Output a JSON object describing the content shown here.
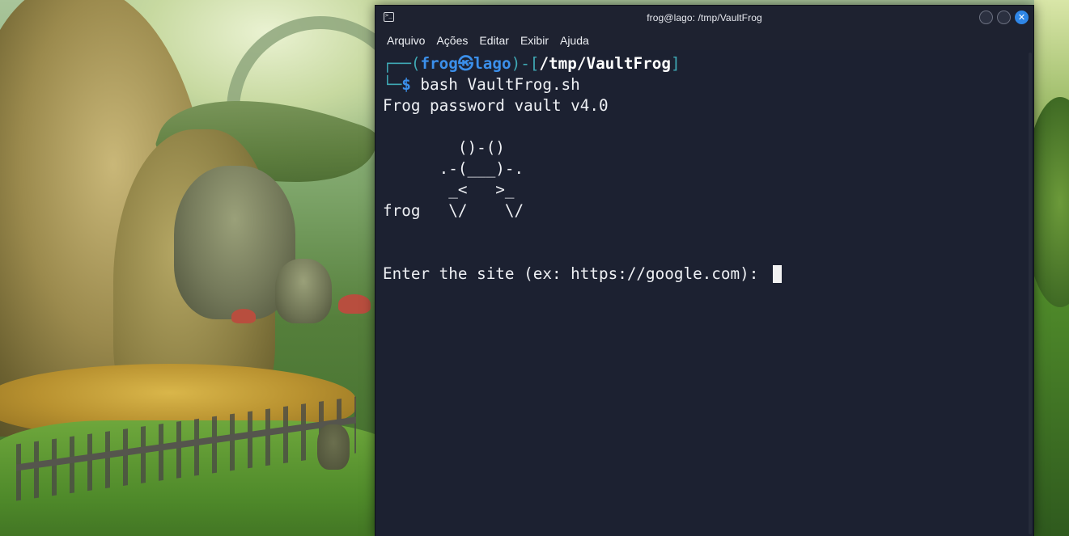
{
  "window": {
    "title": "frog@lago: /tmp/VaultFrog",
    "app_icon": "terminal-icon",
    "app_icon_glyph": ">_",
    "controls": [
      {
        "name": "minimize-button",
        "glyph": ""
      },
      {
        "name": "maximize-button",
        "glyph": ""
      },
      {
        "name": "close-button",
        "glyph": "✕"
      }
    ]
  },
  "menu": {
    "items": [
      "Arquivo",
      "Ações",
      "Editar",
      "Exibir",
      "Ajuda"
    ]
  },
  "prompt": {
    "line1_prefix": "┌──(",
    "user": "frog",
    "at_symbol": "㉿",
    "host": "lago",
    "mid": ")-[",
    "path": "/tmp/VaultFrog",
    "close": "]",
    "line2_prefix": "└─",
    "dollar": "$",
    "command": " bash VaultFrog.sh"
  },
  "output": {
    "header": "Frog password vault v4.0",
    "art": [
      "        ()-()",
      "      .-(___)-.",
      "       _<   >_",
      "frog   \\/    \\/"
    ],
    "input_prompt": "Enter the site (ex: https://google.com): "
  },
  "colors": {
    "terminal_bg": "#1c2131",
    "titlebar_bg": "#1e2230",
    "prompt_teal": "#3fa9b5",
    "prompt_blue": "#3b8fea",
    "close_button": "#2f86e6",
    "text": "#eef0f4"
  }
}
